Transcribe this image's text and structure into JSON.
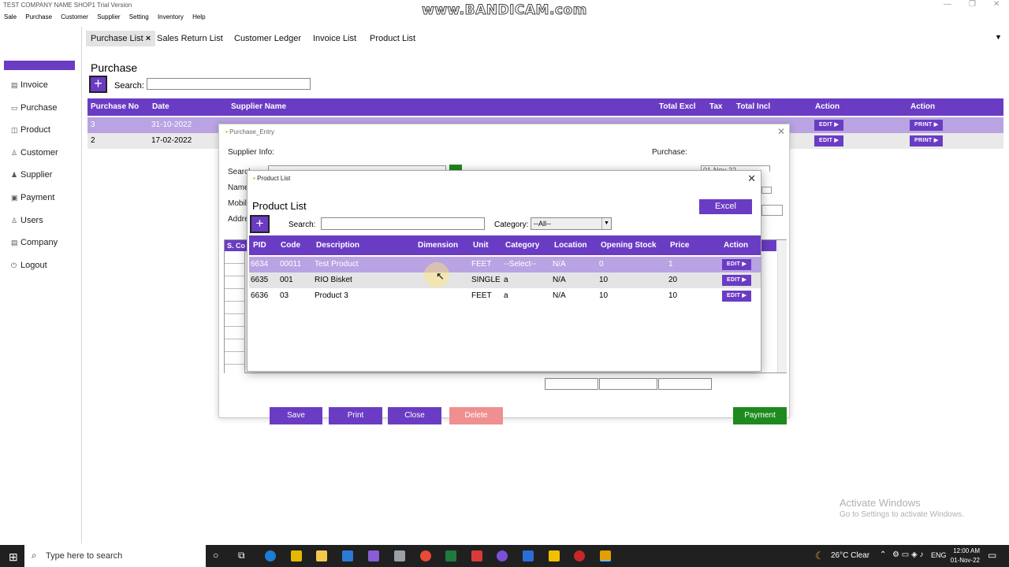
{
  "window": {
    "title": "TEST COMPANY NAME SHOP1 Trial Version",
    "watermark": "www.BANDICAM.com"
  },
  "menu": [
    "Sale",
    "Purchase",
    "Customer",
    "Supplier",
    "Setting",
    "Inventory",
    "Help"
  ],
  "sidebar": {
    "items": [
      {
        "icon": "invoice-icon",
        "label": "Invoice"
      },
      {
        "icon": "purchase-icon",
        "label": "Purchase"
      },
      {
        "icon": "product-icon",
        "label": "Product"
      },
      {
        "icon": "customer-icon",
        "label": "Customer"
      },
      {
        "icon": "supplier-icon",
        "label": "Supplier"
      },
      {
        "icon": "payment-icon",
        "label": "Payment"
      },
      {
        "icon": "users-icon",
        "label": "Users"
      },
      {
        "icon": "company-icon",
        "label": "Company"
      },
      {
        "icon": "logout-icon",
        "label": "Logout"
      }
    ]
  },
  "tabs": [
    {
      "label": "Purchase List",
      "active": true,
      "close": "×"
    },
    {
      "label": "Sales Return List"
    },
    {
      "label": "Customer Ledger"
    },
    {
      "label": "Invoice List"
    },
    {
      "label": "Product List"
    }
  ],
  "purchase": {
    "title": "Purchase",
    "search_label": "Search:",
    "columns": [
      "Purchase No",
      "Date",
      "Supplier Name",
      "Total Excl",
      "Tax",
      "Total Incl",
      "Action",
      "Action"
    ],
    "rows": [
      {
        "no": "3",
        "date": "31-10-2022",
        "edit": "EDIT",
        "print": "PRINT"
      },
      {
        "no": "2",
        "date": "17-02-2022",
        "edit": "EDIT",
        "print": "PRINT"
      }
    ]
  },
  "purchase_entry": {
    "title": "Purchase_Entry",
    "supplier_info": "Supplier Info:",
    "labels": [
      "Search",
      "Name",
      "Mobile",
      "Address"
    ],
    "purchase_label": "Purchase:",
    "date_value": "01-Nov-22",
    "grid_cols": [
      "S.",
      "Co"
    ],
    "buttons": {
      "save": "Save",
      "print": "Print",
      "close": "Close",
      "delete": "Delete",
      "payment": "Payment"
    }
  },
  "product_list": {
    "window_title": "Product List",
    "heading": "Product List",
    "excel": "Excel",
    "search_label": "Search:",
    "category_label": "Category:",
    "category_value": "--All--",
    "columns": [
      "PID",
      "Code",
      "Description",
      "Dimension",
      "Unit",
      "Category",
      "Location",
      "Opening Stock",
      "Price",
      "Action"
    ],
    "rows": [
      {
        "pid": "6634",
        "code": "00011",
        "desc": "Test Product",
        "dim": "",
        "unit": "FEET",
        "cat": "--Select--",
        "loc": "N/A",
        "stock": "0",
        "price": "1",
        "action": "EDIT"
      },
      {
        "pid": "6635",
        "code": "001",
        "desc": "RIO Bisket",
        "dim": "",
        "unit": "SINGLE",
        "cat": "a",
        "loc": "N/A",
        "stock": "10",
        "price": "20",
        "action": "EDIT"
      },
      {
        "pid": "6636",
        "code": "03",
        "desc": "Product 3",
        "dim": "",
        "unit": "FEET",
        "cat": "a",
        "loc": "N/A",
        "stock": "10",
        "price": "10",
        "action": "EDIT"
      }
    ]
  },
  "activate": {
    "title": "Activate Windows",
    "sub": "Go to Settings to activate Windows."
  },
  "taskbar": {
    "search_placeholder": "Type here to search",
    "weather": "26°C  Clear",
    "lang": "ENG",
    "time": "12:00 AM",
    "date": "01-Nov-22"
  },
  "colors": {
    "accent": "#6a3cc4",
    "selected_row": "#b9a3e3",
    "payment": "#1d8a1d",
    "delete": "#ef8f8f"
  }
}
